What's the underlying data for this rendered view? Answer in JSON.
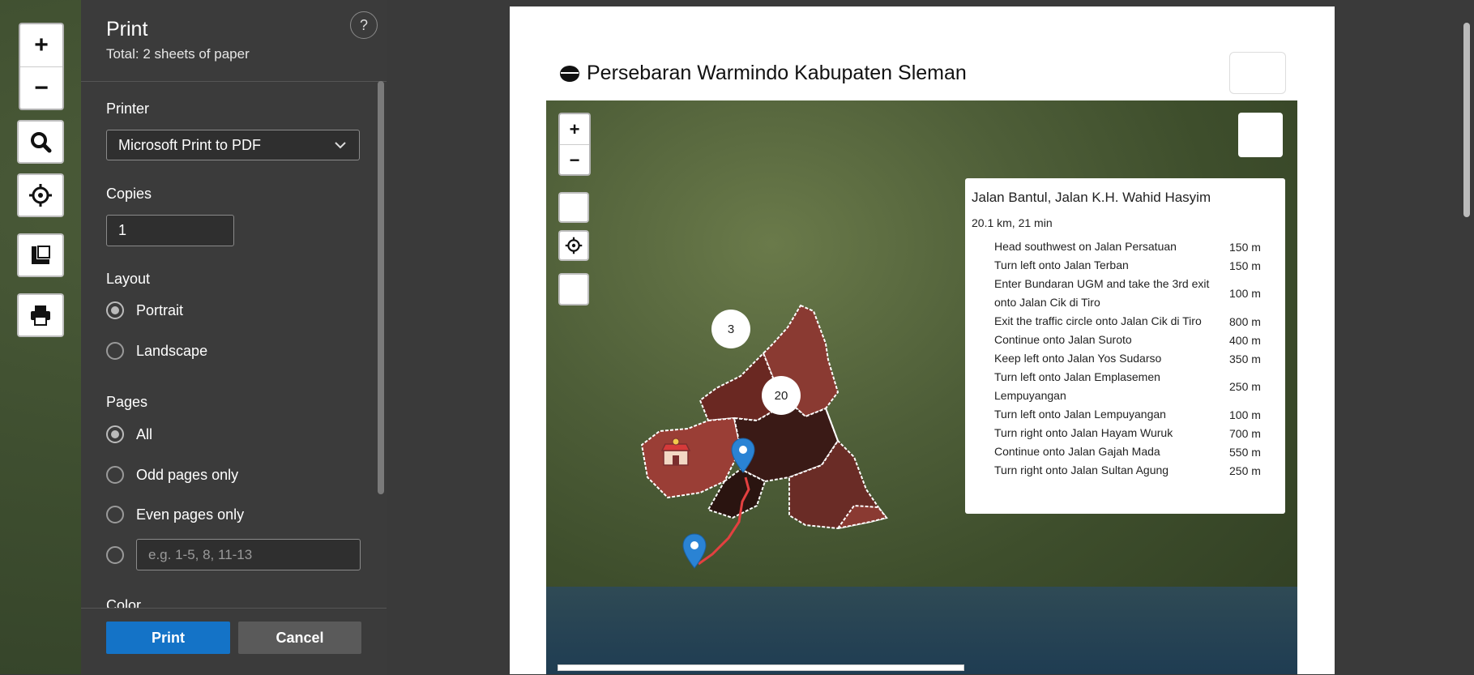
{
  "background_map": {
    "zoom_in": "+",
    "zoom_out": "−"
  },
  "print_panel": {
    "title": "Print",
    "total": "Total: 2 sheets of paper",
    "help": "?",
    "printer_label": "Printer",
    "printer_value": "Microsoft Print to PDF",
    "copies_label": "Copies",
    "copies_value": "1",
    "layout_label": "Layout",
    "layout_options": [
      "Portrait",
      "Landscape"
    ],
    "layout_selected": "Portrait",
    "pages_label": "Pages",
    "pages_options": [
      "All",
      "Odd pages only",
      "Even pages only"
    ],
    "pages_selected": "All",
    "pages_custom_placeholder": "e.g. 1-5, 8, 11-13",
    "color_label": "Color",
    "print_button": "Print",
    "cancel_button": "Cancel"
  },
  "preview": {
    "page_title": "Persebaran Warmindo Kabupaten Sleman",
    "map": {
      "zoom_in": "+",
      "zoom_out": "−",
      "clusters": [
        "3",
        "20"
      ]
    },
    "route": {
      "title": "Jalan Bantul, Jalan K.H. Wahid Hasyim",
      "summary": "20.1 km, 21 min",
      "steps": [
        {
          "instruction": "Head southwest on Jalan Persatuan",
          "distance": "150 m"
        },
        {
          "instruction": "Turn left onto Jalan Terban",
          "distance": "150 m"
        },
        {
          "instruction": "Enter Bundaran UGM and take the 3rd exit onto Jalan Cik di Tiro",
          "distance": "100 m"
        },
        {
          "instruction": "Exit the traffic circle onto Jalan Cik di Tiro",
          "distance": "800 m"
        },
        {
          "instruction": "Continue onto Jalan Suroto",
          "distance": "400 m"
        },
        {
          "instruction": "Keep left onto Jalan Yos Sudarso",
          "distance": "350 m"
        },
        {
          "instruction": "Turn left onto Jalan Emplasemen Lempuyangan",
          "distance": "250 m"
        },
        {
          "instruction": "Turn left onto Jalan Lempuyangan",
          "distance": "100 m"
        },
        {
          "instruction": "Turn right onto Jalan Hayam Wuruk",
          "distance": "700 m"
        },
        {
          "instruction": "Continue onto Jalan Gajah Mada",
          "distance": "550 m"
        },
        {
          "instruction": "Turn right onto Jalan Sultan Agung",
          "distance": "250 m"
        }
      ]
    }
  }
}
